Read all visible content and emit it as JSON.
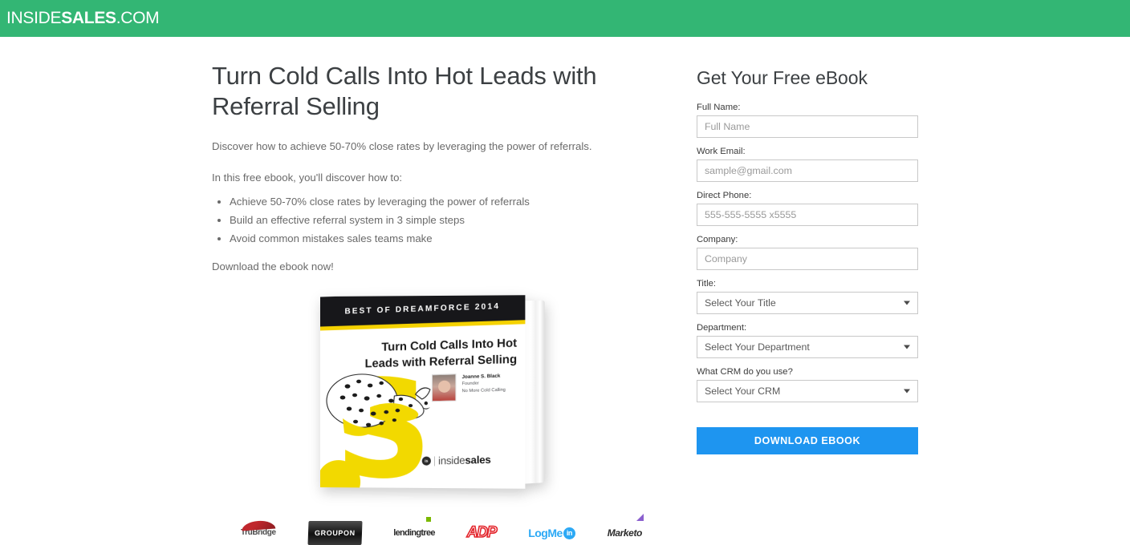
{
  "header": {
    "logo_prefix": "INSIDE",
    "logo_bold": "SALES",
    "logo_suffix": ".COM",
    "background_color": "#33b674"
  },
  "main": {
    "headline": "Turn Cold Calls Into Hot Leads with Referral Selling",
    "subtext": "Discover how to achieve 50-70% close rates by leveraging the power of referrals.",
    "lead_in": "In this free ebook, you'll discover how to:",
    "benefits": [
      "Achieve 50-70% close rates by leveraging the power of referrals",
      "Build an effective referral system in 3 simple steps",
      "Avoid common mistakes sales teams make"
    ],
    "closing": "Download the ebook now!"
  },
  "ebook_cover": {
    "award_band": "BEST OF DREAMFORCE 2014",
    "title": "Turn Cold Calls Into Hot Leads with Referral Selling",
    "author_name": "Joanne S. Black",
    "author_role": "Founder",
    "author_company": "No More Cold Calling",
    "brand_mark": "is",
    "brand_text_light": "inside",
    "brand_text_bold": "sales",
    "accent_color": "#f2d900"
  },
  "clients": [
    {
      "name": "TruBridge",
      "label": "TruBridge"
    },
    {
      "name": "Groupon",
      "label": "GROUPON"
    },
    {
      "name": "LendingTree",
      "label": "lendingtree"
    },
    {
      "name": "ADP",
      "label": "ADP"
    },
    {
      "name": "LogMeIn",
      "label": "LogMe",
      "badge": "in"
    },
    {
      "name": "Marketo",
      "label": "Marketo"
    }
  ],
  "form": {
    "title": "Get Your Free eBook",
    "fields": [
      {
        "label": "Full Name:",
        "placeholder": "Full Name",
        "type": "text"
      },
      {
        "label": "Work Email:",
        "placeholder": "sample@gmail.com",
        "type": "email"
      },
      {
        "label": "Direct Phone:",
        "placeholder": "555-555-5555 x5555",
        "type": "tel"
      },
      {
        "label": "Company:",
        "placeholder": "Company",
        "type": "text"
      },
      {
        "label": "Title:",
        "selected": "Select Your Title",
        "type": "select"
      },
      {
        "label": "Department:",
        "selected": "Select Your Department",
        "type": "select"
      },
      {
        "label": "What CRM do you use?",
        "selected": "Select Your CRM",
        "type": "select"
      }
    ],
    "submit_label": "DOWNLOAD EBOOK",
    "submit_color": "#1e95f0"
  }
}
